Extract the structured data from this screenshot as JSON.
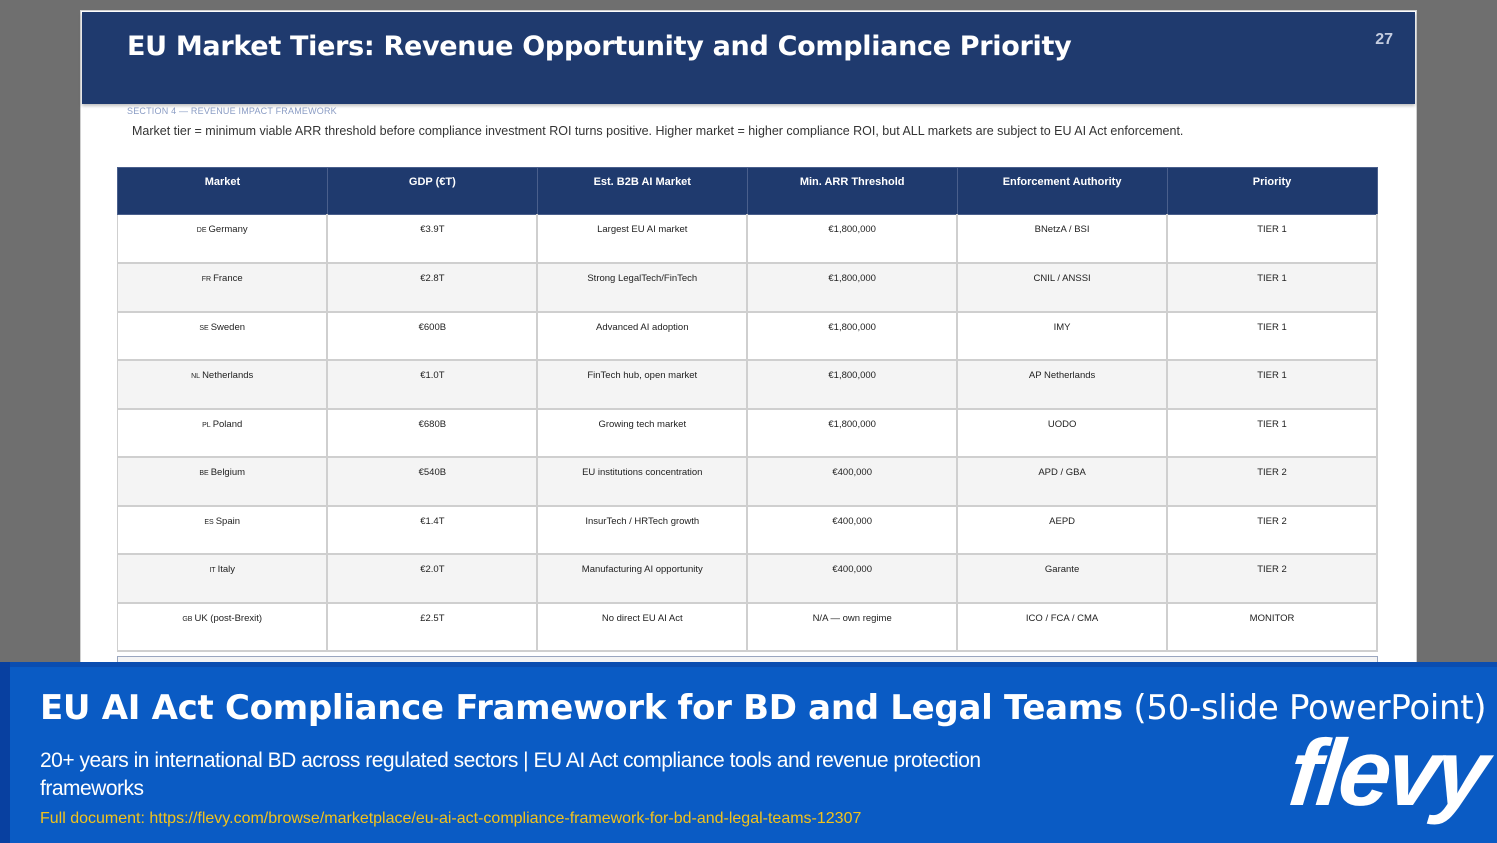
{
  "slide": {
    "title": "EU Market Tiers: Revenue Opportunity and Compliance Priority",
    "number": "27",
    "section_label": "SECTION 4 — REVENUE IMPACT FRAMEWORK",
    "description": "Market tier = minimum viable ARR threshold before compliance investment ROI turns positive. Higher market = higher compliance ROI, but ALL markets are subject to EU AI Act enforcement."
  },
  "table": {
    "headers": [
      "Market",
      "GDP (€T)",
      "Est. B2B AI Market",
      "Min. ARR Threshold",
      "Enforcement Authority",
      "Priority"
    ],
    "rows": [
      {
        "flag": "DE",
        "market": "Germany",
        "gdp": "€3.9T",
        "ai_market": "Largest EU AI market",
        "arr": "€1,800,000",
        "authority": "BNetzA / BSI",
        "priority": "TIER 1"
      },
      {
        "flag": "FR",
        "market": "France",
        "gdp": "€2.8T",
        "ai_market": "Strong LegalTech/FinTech",
        "arr": "€1,800,000",
        "authority": "CNIL / ANSSI",
        "priority": "TIER 1"
      },
      {
        "flag": "SE",
        "market": "Sweden",
        "gdp": "€600B",
        "ai_market": "Advanced AI adoption",
        "arr": "€1,800,000",
        "authority": "IMY",
        "priority": "TIER 1"
      },
      {
        "flag": "NL",
        "market": "Netherlands",
        "gdp": "€1.0T",
        "ai_market": "FinTech hub, open market",
        "arr": "€1,800,000",
        "authority": "AP Netherlands",
        "priority": "TIER 1"
      },
      {
        "flag": "PL",
        "market": "Poland",
        "gdp": "€680B",
        "ai_market": "Growing tech market",
        "arr": "€1,800,000",
        "authority": "UODO",
        "priority": "TIER 1"
      },
      {
        "flag": "BE",
        "market": "Belgium",
        "gdp": "€540B",
        "ai_market": "EU institutions concentration",
        "arr": "€400,000",
        "authority": "APD / GBA",
        "priority": "TIER 2"
      },
      {
        "flag": "ES",
        "market": "Spain",
        "gdp": "€1.4T",
        "ai_market": "InsurTech / HRTech growth",
        "arr": "€400,000",
        "authority": "AEPD",
        "priority": "TIER 2"
      },
      {
        "flag": "IT",
        "market": "Italy",
        "gdp": "€2.0T",
        "ai_market": "Manufacturing AI opportunity",
        "arr": "€400,000",
        "authority": "Garante",
        "priority": "TIER 2"
      },
      {
        "flag": "GB",
        "market": "UK (post-Brexit)",
        "gdp": "£2.5T",
        "ai_market": "No direct EU AI Act",
        "arr": "N/A — own regime",
        "authority": "ICO / FCA / CMA",
        "priority": "MONITOR"
      }
    ]
  },
  "banner": {
    "title_strong": "EU AI Act Compliance Framework for BD and Legal Teams",
    "title_light": " (50-slide PowerPoint)",
    "subtitle": "20+ years in international BD across regulated  sectors | EU AI Act compliance tools and  revenue protection frameworks",
    "link": "Full document: https://flevy.com/browse/marketplace/eu-ai-act-compliance-framework-for-bd-and-legal-teams-12307",
    "logo": "flevy"
  },
  "colors": {
    "header_navy": "#1f3a6e",
    "banner_blue": "#0a5bc4",
    "link_yellow": "#f2c21b"
  }
}
